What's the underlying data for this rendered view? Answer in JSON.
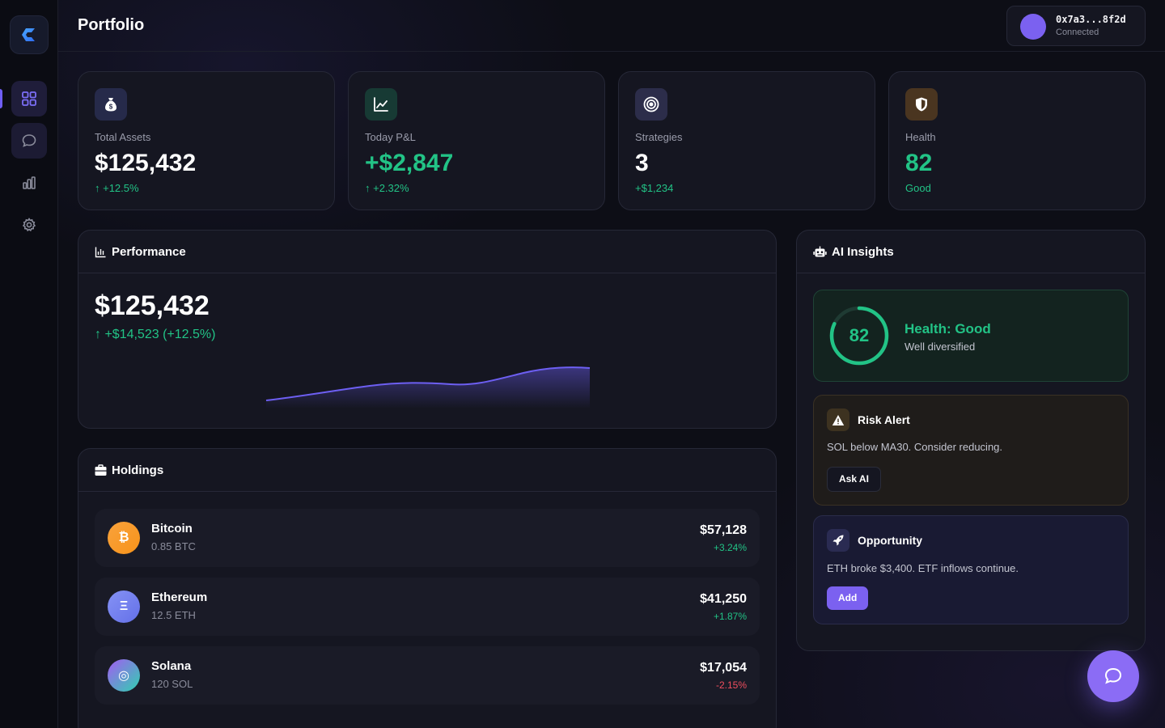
{
  "header": {
    "title": "Portfolio",
    "wallet": {
      "address": "0x7a3...8f2d",
      "status": "Connected"
    }
  },
  "sidebar": {
    "items": [
      {
        "name": "dashboard",
        "icon": "grid-icon",
        "active": true
      },
      {
        "name": "chat",
        "icon": "chat-bubble-icon"
      },
      {
        "name": "analytics",
        "icon": "bar-chart-icon"
      },
      {
        "name": "settings",
        "icon": "gear-icon"
      }
    ]
  },
  "stats": [
    {
      "icon": "money-bag-icon",
      "label": "Total Assets",
      "value": "$125,432",
      "sub": "↑ +12.5%"
    },
    {
      "icon": "line-chart-icon",
      "label": "Today P&L",
      "value": "+$2,847",
      "sub": "↑ +2.32%"
    },
    {
      "icon": "target-icon",
      "label": "Strategies",
      "value": "3",
      "sub": "+$1,234"
    },
    {
      "icon": "shield-icon",
      "label": "Health",
      "value": "82",
      "sub": "Good"
    }
  ],
  "performance": {
    "title": "Performance",
    "value": "$125,432",
    "change": "↑ +$14,523 (+12.5%)"
  },
  "holdings": {
    "title": "Holdings",
    "items": [
      {
        "symbol": "₿",
        "name": "Bitcoin",
        "amount": "0.85 BTC",
        "value": "$57,128",
        "change": "+3.24%",
        "color": "#f7931a"
      },
      {
        "symbol": "Ξ",
        "name": "Ethereum",
        "amount": "12.5 ETH",
        "value": "$41,250",
        "change": "+1.87%",
        "color": "#6f7cf0"
      },
      {
        "symbol": "◎",
        "name": "Solana",
        "amount": "120 SOL",
        "value": "$17,054",
        "change": "-2.15%",
        "color": "#9b5cf0"
      }
    ]
  },
  "insights": {
    "title": "AI Insights",
    "health": {
      "score": "82",
      "score_fraction": 0.82,
      "title": "Health: Good",
      "sub": "Well diversified"
    },
    "risk": {
      "title": "Risk Alert",
      "text": "SOL below MA30. Consider reducing.",
      "button": "Ask AI"
    },
    "opportunity": {
      "title": "Opportunity",
      "text": "ETH broke $3,400. ETF inflows continue.",
      "button": "Add"
    }
  },
  "colors": {
    "accent": "#7b61f0",
    "positive": "#22c386",
    "negative": "#f04e5e"
  }
}
